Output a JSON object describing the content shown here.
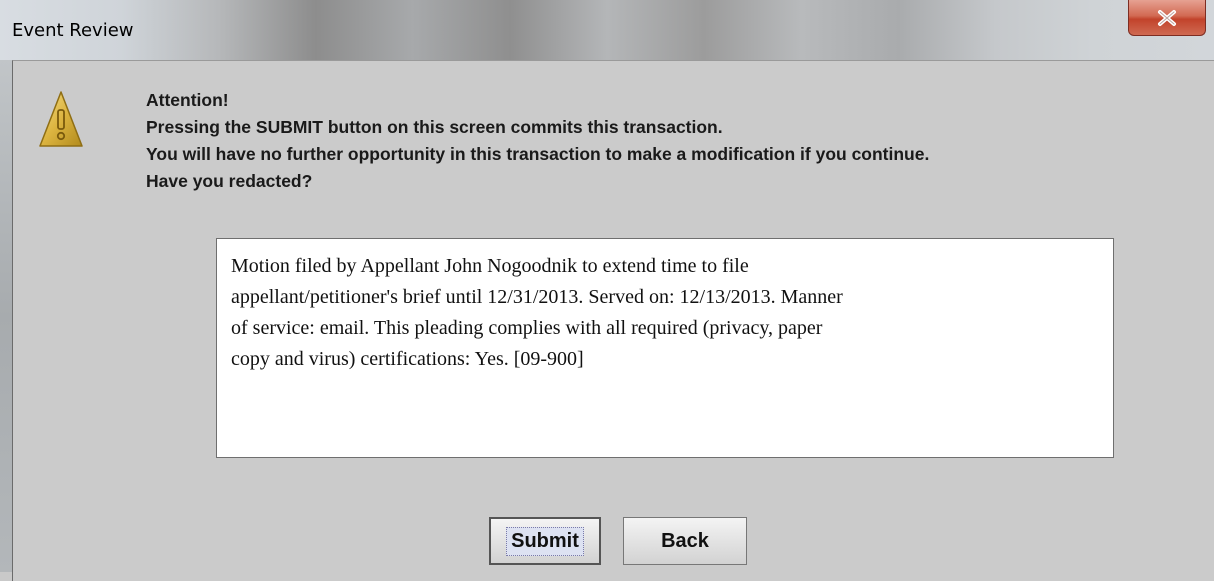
{
  "window": {
    "title": "Event Review",
    "close_label": "X"
  },
  "message": {
    "lines": [
      "Attention!",
      "Pressing the SUBMIT button on this screen commits this transaction.",
      "You will have no further opportunity in this transaction to make a modification if you continue.",
      "Have you redacted?"
    ],
    "icon": "warning-icon"
  },
  "docket_text": {
    "lines": [
      "Motion filed by Appellant John Nogoodnik to extend time to file",
      "appellant/petitioner's brief until 12/31/2013. Served on: 12/13/2013. Manner",
      "of service: email. This pleading complies with all required (privacy, paper",
      "copy and virus) certifications: Yes. [09-900]"
    ]
  },
  "buttons": {
    "submit": "Submit",
    "back": "Back"
  },
  "colors": {
    "dialog_bg": "#cbcbcb",
    "close_button": "#c8482f",
    "warning_icon": "#d9b23a"
  }
}
